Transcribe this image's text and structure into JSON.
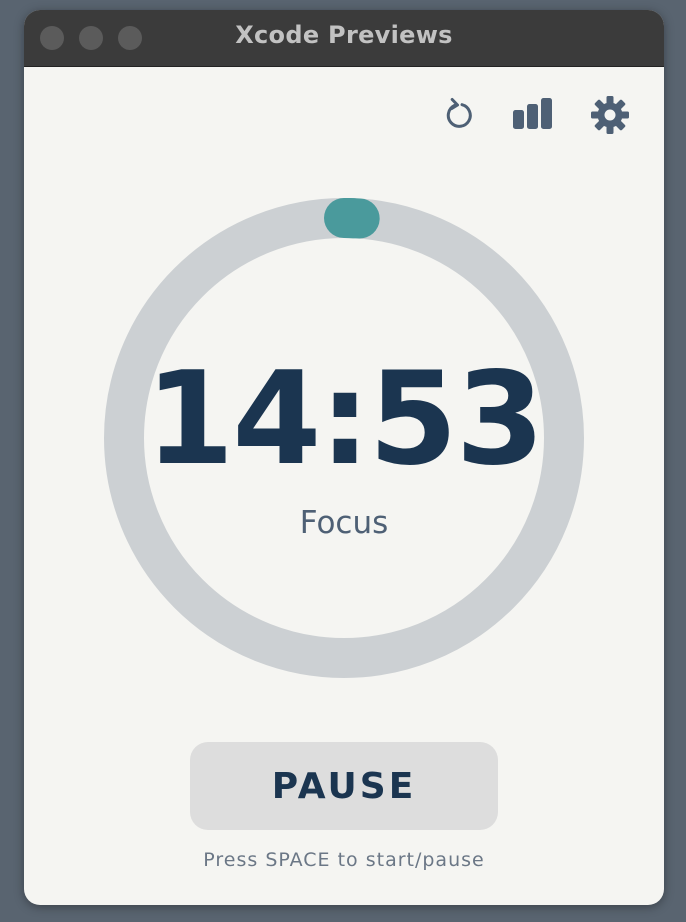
{
  "window": {
    "title": "Xcode Previews"
  },
  "toolbar": {
    "icons": [
      "reset-icon",
      "stats-icon",
      "gear-icon"
    ]
  },
  "timer": {
    "time": "14:53",
    "mode": "Focus",
    "progress": 0.007
  },
  "controls": {
    "pause_label": "PAUSE",
    "hint": "Press SPACE to start/pause"
  },
  "colors": {
    "accent": "#4a9a9c",
    "track": "#ccd0d3",
    "text_primary": "#1b3550",
    "text_secondary": "#4e6075",
    "button_bg": "#dddddd",
    "window_bg": "#f5f5f2"
  }
}
